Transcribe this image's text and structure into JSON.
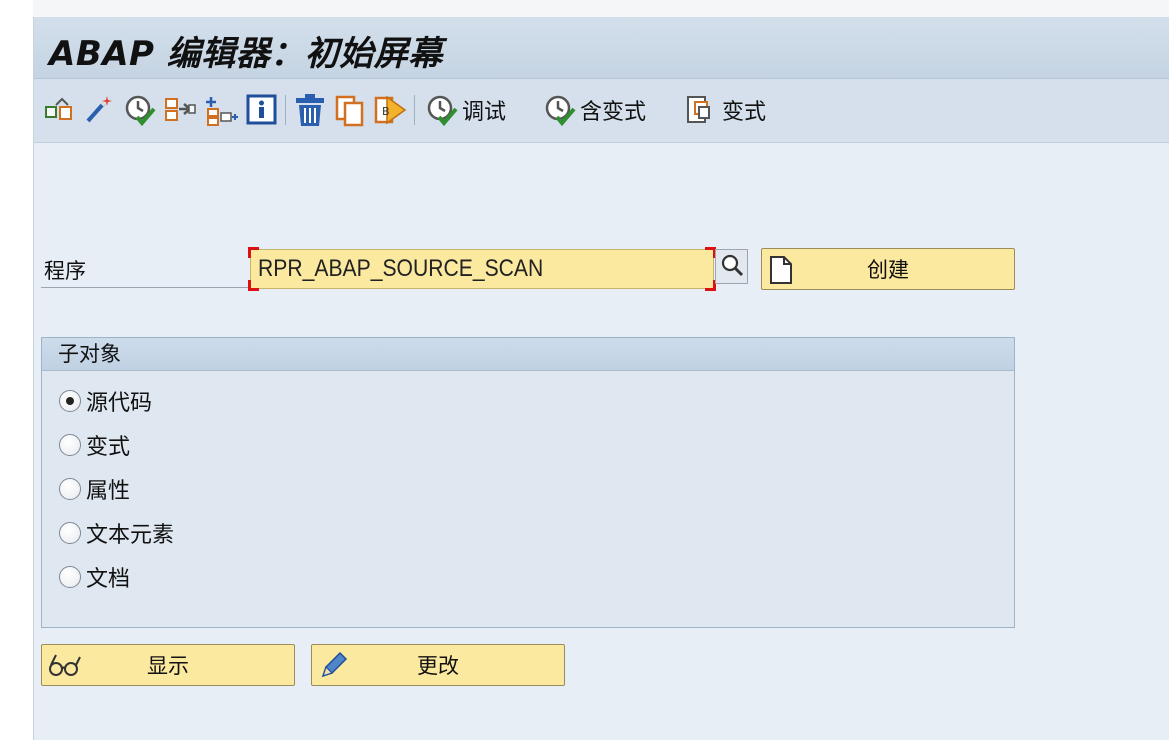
{
  "window": {
    "title": "ABAP 编辑器：初始屏幕"
  },
  "toolbar": {
    "icons": [
      "other-object-icon",
      "magic-wand-icon",
      "check-icon",
      "where-used-icon",
      "object-list-icon",
      "info-icon",
      "delete-icon",
      "copy-icon",
      "execute-icon"
    ],
    "debug_label": "调试",
    "with_variant_label": "含变式",
    "variants_label": "变式"
  },
  "program": {
    "label": "程序",
    "value": "RPR_ABAP_SOURCE_SCAN",
    "create_label": "创建"
  },
  "subobjects": {
    "title": "子对象",
    "options": [
      {
        "label": "源代码",
        "selected": true
      },
      {
        "label": "变式",
        "selected": false
      },
      {
        "label": "属性",
        "selected": false
      },
      {
        "label": "文本元素",
        "selected": false
      },
      {
        "label": "文档",
        "selected": false
      }
    ]
  },
  "actions": {
    "display_label": "显示",
    "change_label": "更改"
  },
  "colors": {
    "button_yellow": "#fce9a0",
    "header_blue": "#c5d4e3",
    "background": "#e8eef5"
  }
}
